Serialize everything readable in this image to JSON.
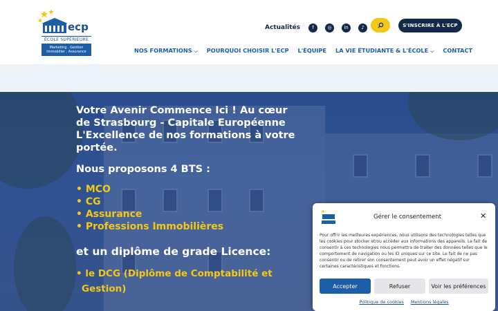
{
  "brand": {
    "logo_text": "ecp",
    "school_label": "ÉCOLE SUPÉRIEURE",
    "tagline_lines": [
      "Marketing . Gestion",
      "Immobilier . Assurance"
    ]
  },
  "header": {
    "news_label": "Actualités",
    "social_icons": [
      "facebook-icon",
      "instagram-icon",
      "linkedin-icon",
      "tiktok-icon"
    ],
    "cta_label": "S'INSCRIRE À L'ECP"
  },
  "nav": {
    "items": [
      {
        "label": "NOS FORMATIONS",
        "dropdown": true
      },
      {
        "label": "POURQUOI CHOISIR L'ECP",
        "dropdown": false
      },
      {
        "label": "L'ÉQUIPE",
        "dropdown": false
      },
      {
        "label": "LA VIE ÉTUDIANTE & L'ÉCOLE",
        "dropdown": true
      },
      {
        "label": "CONTACT",
        "dropdown": false
      }
    ]
  },
  "hero": {
    "headline": "Votre Avenir Commence Ici ! Au cœur de Strasbourg - Capitale Européenne L'Excellence de nos formations à votre portée.",
    "subhead": "Nous proposons 4 BTS :",
    "bts": [
      "MCO",
      "CG",
      "Assurance",
      "Professions Immobilières"
    ],
    "licence_title": "et un diplôme de grade Licence:",
    "dcg": "le DCG (Diplôme de Comptabilité et Gestion)"
  },
  "consent": {
    "title": "Gérer le consentement",
    "body": "Pour offrir les meilleures expériences, nous utilisons des technologies telles que les cookies pour stocker et/ou accéder aux informations des appareils. Le fait de consentir à ces technologies nous permettra de traiter des données telles que le comportement de navigation ou les ID uniques sur ce site. Le fait de ne pas consentir ou de retirer son consentement peut avoir un effet négatif sur certaines caractéristiques et fonctions.",
    "accept_label": "Accepter",
    "refuse_label": "Refuser",
    "prefs_label": "Voir les préférences",
    "cookie_policy_label": "Politique de cookies",
    "legal_label": "Mentions légales"
  },
  "colors": {
    "brand_blue": "#1d5ea8",
    "navy": "#14284b",
    "accent_yellow": "#f3c818"
  }
}
